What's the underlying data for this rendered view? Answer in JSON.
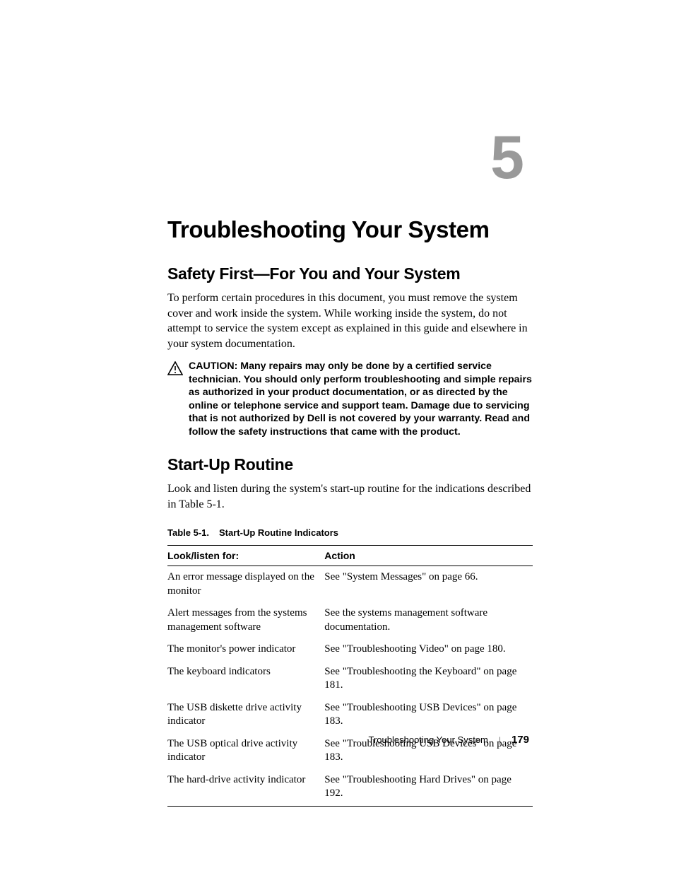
{
  "chapter": {
    "number": "5",
    "title": "Troubleshooting Your System"
  },
  "section1": {
    "heading": "Safety First—For You and Your System",
    "body": "To perform certain procedures in this document, you must remove the system cover and work inside the system. While working inside the system, do not attempt to service the system except as explained in this guide and elsewhere in your system documentation.",
    "caution_label": "CAUTION: ",
    "caution_text": "Many repairs may only be done by a certified service technician. You should only perform troubleshooting and simple repairs as authorized in your product documentation, or as directed by the online or telephone service and support team. Damage due to servicing that is not authorized by Dell is not covered by your warranty. Read and follow the safety instructions that came with the product."
  },
  "section2": {
    "heading": "Start-Up Routine",
    "body": "Look and listen during the system's start-up routine for the indications described in Table 5-1."
  },
  "table": {
    "caption_num": "Table 5-1.",
    "caption_title": "Start-Up Routine Indicators",
    "headers": {
      "col1": "Look/listen for:",
      "col2": "Action"
    },
    "rows": [
      {
        "look": "An error message displayed on the monitor",
        "action": "See \"System Messages\" on page 66."
      },
      {
        "look": "Alert messages from the systems management software",
        "action": "See the systems management software documentation."
      },
      {
        "look": "The monitor's power indicator",
        "action": "See \"Troubleshooting Video\" on page 180."
      },
      {
        "look": "The keyboard indicators",
        "action": "See \"Troubleshooting the Keyboard\" on page 181."
      },
      {
        "look": "The USB diskette drive activity indicator",
        "action": "See \"Troubleshooting USB Devices\" on page 183."
      },
      {
        "look": "The USB optical drive activity indicator",
        "action": "See \"Troubleshooting USB Devices\" on page 183."
      },
      {
        "look": "The hard-drive activity indicator",
        "action": "See \"Troubleshooting Hard Drives\" on page 192."
      }
    ]
  },
  "footer": {
    "title": "Troubleshooting Your System",
    "page": "179"
  }
}
